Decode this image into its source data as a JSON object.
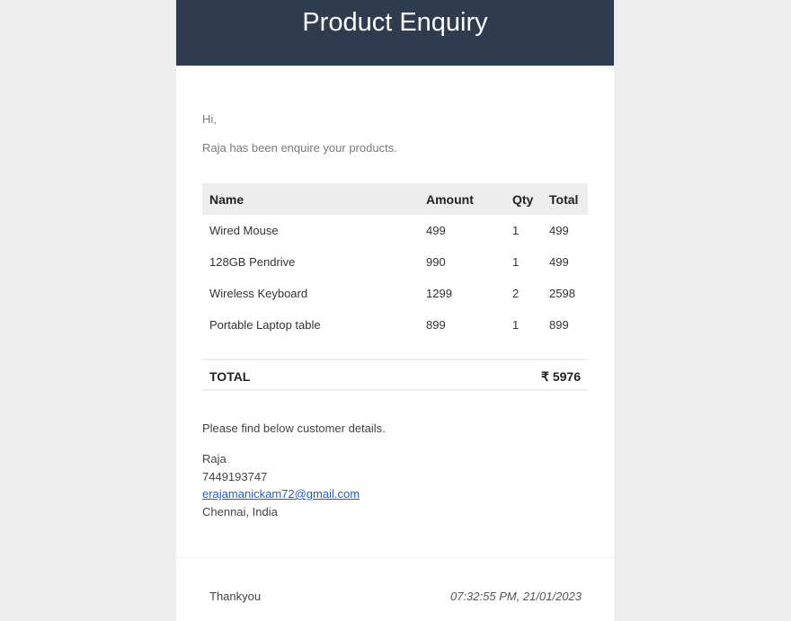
{
  "header": {
    "title": "Product Enquiry",
    "background": "#2f3b4f"
  },
  "body": {
    "greeting": "Hi,",
    "intro": "Raja has been enquire your products."
  },
  "table": {
    "headers": {
      "name": "Name",
      "amount": "Amount",
      "qty": "Qty",
      "total": "Total"
    },
    "rows": [
      {
        "name": "Wired Mouse",
        "amount": "499",
        "qty": "1",
        "total": "499"
      },
      {
        "name": "128GB Pendrive",
        "amount": "990",
        "qty": "1",
        "total": "499"
      },
      {
        "name": "Wireless Keyboard",
        "amount": "1299",
        "qty": "2",
        "total": "2598"
      },
      {
        "name": "Portable Laptop table",
        "amount": "899",
        "qty": "1",
        "total": "899"
      }
    ],
    "total_label": "TOTAL",
    "total_value": "₹ 5976"
  },
  "customer": {
    "intro": "Please find below customer details.",
    "name": "Raja",
    "phone": "7449193747",
    "email": "erajamanickam72@gmail.com",
    "location": "Chennai, India",
    "link_color": "#1a5fd8"
  },
  "footer": {
    "left": "Thankyou",
    "timestamp": "07:32:55 PM, 21/01/2023"
  }
}
